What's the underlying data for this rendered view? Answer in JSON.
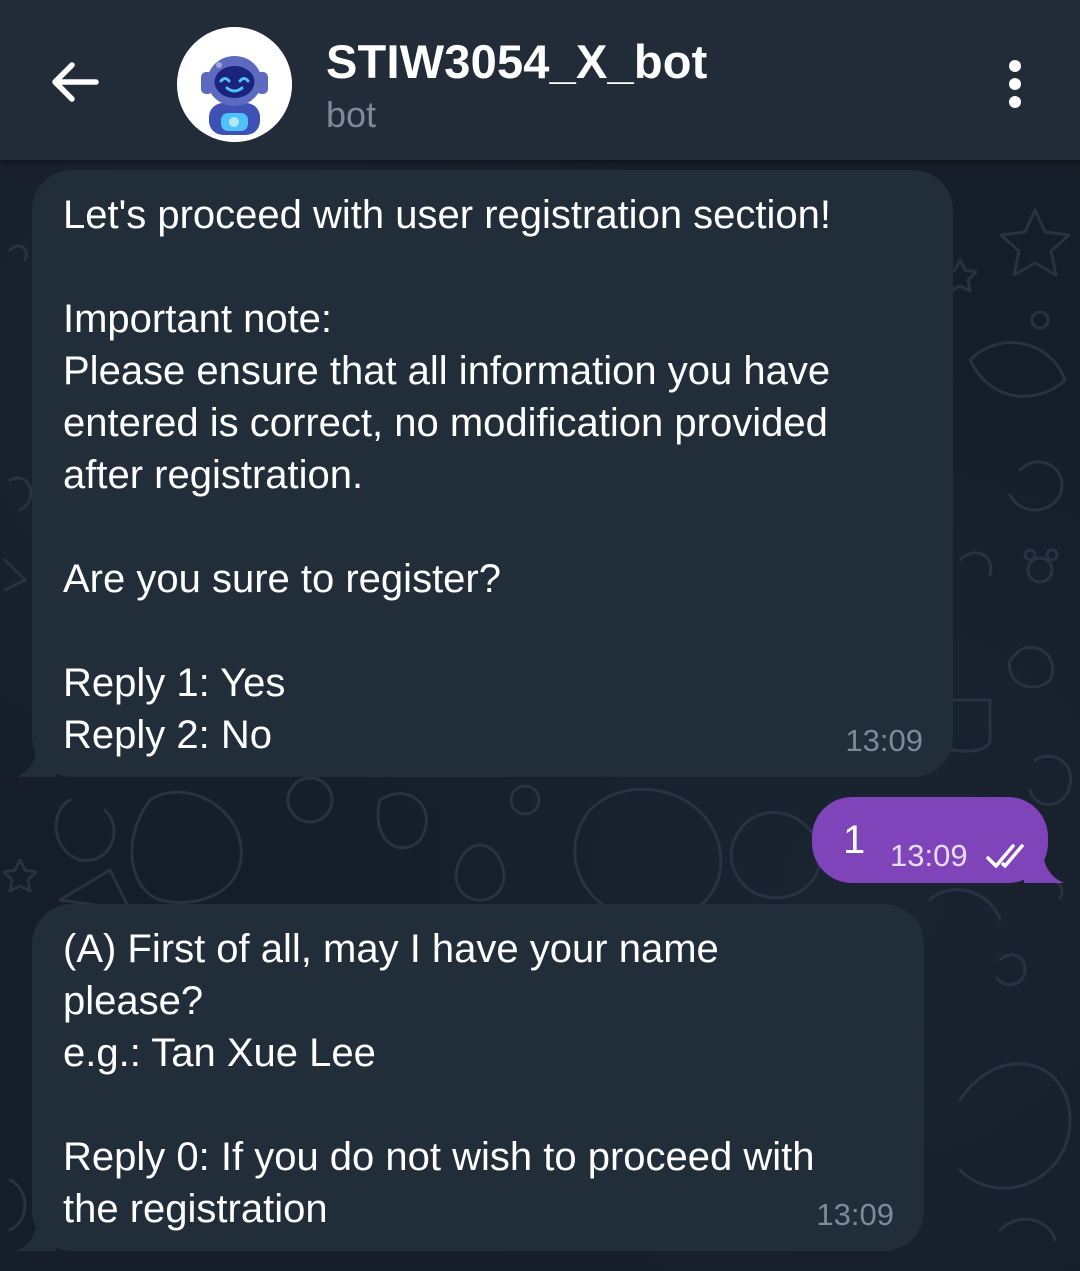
{
  "header": {
    "title": "STIW3054_X_bot",
    "status": "bot",
    "back_icon": "arrow-left-icon",
    "menu_icon": "more-vertical-icon",
    "avatar_icon": "robot-avatar-icon"
  },
  "messages": [
    {
      "direction": "incoming",
      "text": "Let's proceed with user registration section!\n\nImportant note:\nPlease ensure that all information you have\nentered is correct, no modification provided\nafter registration.\n\nAre you sure to register?\n\nReply 1: Yes\nReply 2: No",
      "time": "13:09"
    },
    {
      "direction": "outgoing",
      "text": "1",
      "time": "13:09",
      "status_icon": "double-check-icon"
    },
    {
      "direction": "incoming",
      "text": "(A) First of all, may I have your name\nplease?\ne.g.: Tan Xue Lee\n\nReply 0: If you do not wish to proceed with\nthe registration",
      "time": "13:09"
    }
  ],
  "colors": {
    "background": "#151d28",
    "header": "#222c39",
    "incoming_bubble": "#222d3a",
    "outgoing_bubble": "#7f44b9",
    "muted_text": "#7f8a98"
  }
}
